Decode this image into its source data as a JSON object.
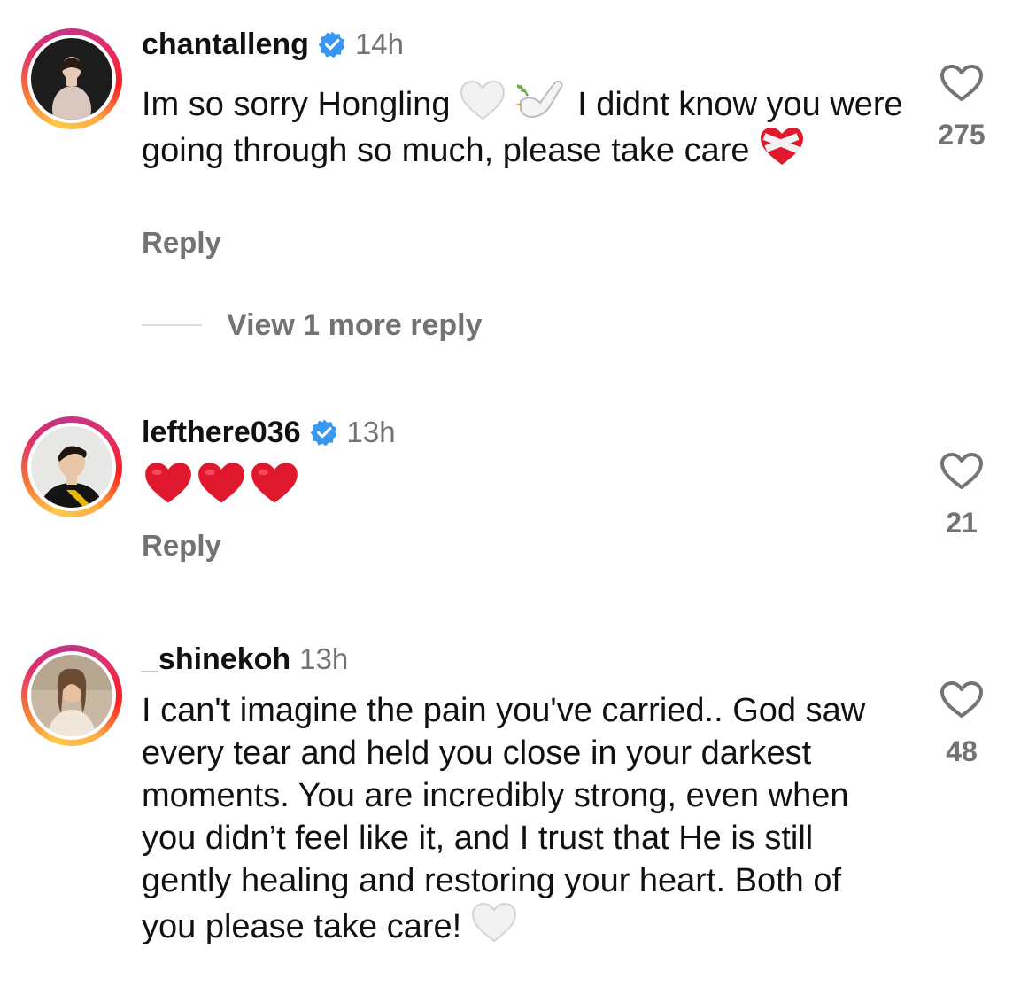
{
  "comments": [
    {
      "username": "chantalleng",
      "verified": true,
      "time": "14h",
      "text_part1": "Im so sorry Hongling",
      "text_part2": "I didnt know you were going through so much, please take care",
      "emoji_after_part1": [
        "white-heart-icon",
        "dove-icon"
      ],
      "emoji_after_part2": [
        "mending-heart-icon"
      ],
      "reply_label": "Reply",
      "likes": "275"
    },
    {
      "username": "lefthere036",
      "verified": true,
      "time": "13h",
      "emoji_body": [
        "red-heart-icon",
        "red-heart-icon",
        "red-heart-icon"
      ],
      "reply_label": "Reply",
      "likes": "21"
    },
    {
      "username": "_shinekoh",
      "verified": false,
      "time": "13h",
      "text": "I can't imagine the pain you've carried.. God saw every tear and held you close in your darkest moments. You are incredibly strong, even when you didn’t feel like it, and I trust that He is still gently healing and restoring your heart. Both of you please take care!",
      "emoji_after_text": [
        "white-heart-icon"
      ],
      "likes": "48"
    }
  ],
  "view_more_replies": "View 1 more reply",
  "colors": {
    "primary_text": "#111111",
    "secondary_text": "#737373",
    "verified_badge": "#3897f0",
    "heart_emoji": "#e0182d",
    "divider": "#dbdbdb"
  }
}
